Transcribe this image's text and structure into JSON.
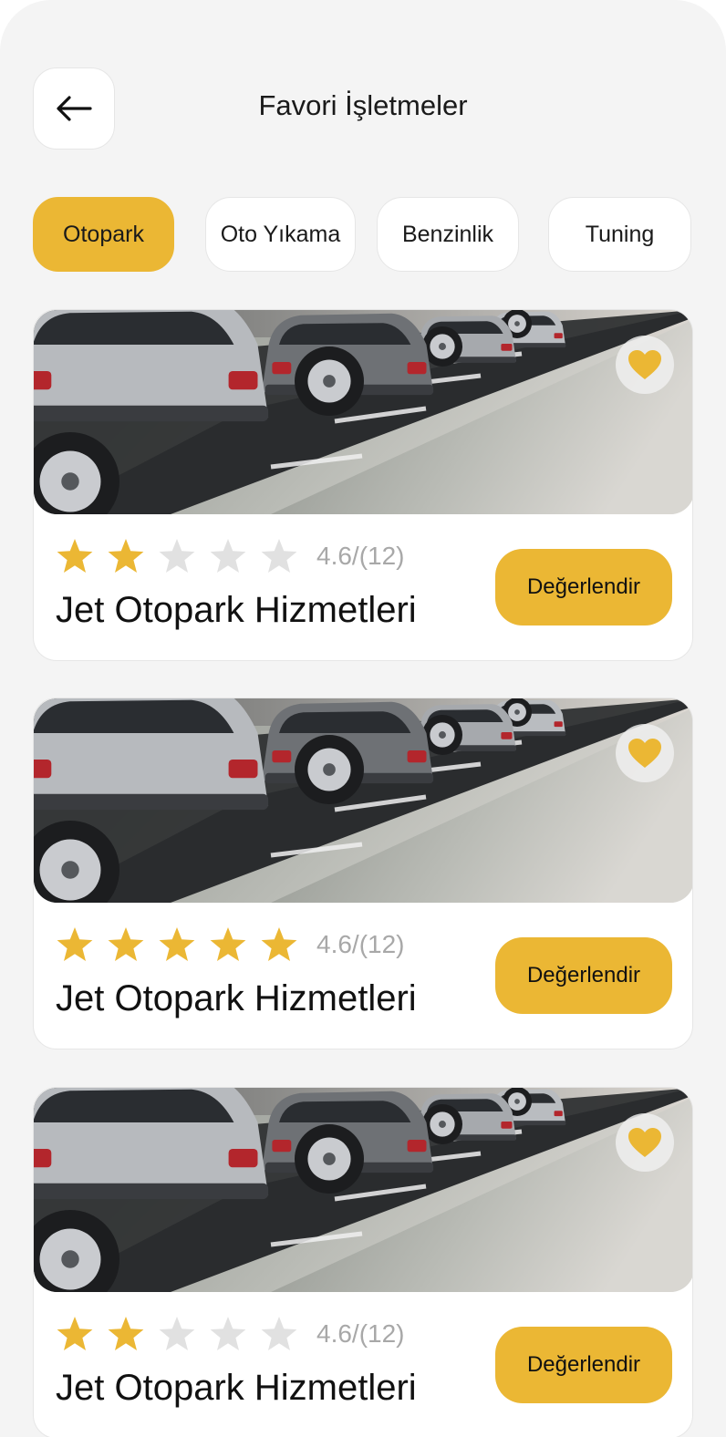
{
  "header": {
    "title": "Favori İşletmeler"
  },
  "tabs": [
    {
      "label": "Otopark",
      "active": true
    },
    {
      "label": "Oto Yıkama",
      "active": false
    },
    {
      "label": "Benzinlik",
      "active": false
    },
    {
      "label": "Tuning",
      "active": false
    }
  ],
  "listings": [
    {
      "name": "Jet Otopark Hizmetleri",
      "rating_text": "4.6/(12)",
      "stars_filled": 2,
      "stars_total": 5,
      "button_label": "Değerlendir",
      "favorite": true
    },
    {
      "name": "Jet Otopark Hizmetleri",
      "rating_text": "4.6/(12)",
      "stars_filled": 5,
      "stars_total": 5,
      "button_label": "Değerlendir",
      "favorite": true
    },
    {
      "name": "Jet Otopark Hizmetleri",
      "rating_text": "4.6/(12)",
      "stars_filled": 2,
      "stars_total": 5,
      "button_label": "Değerlendir",
      "favorite": true
    }
  ],
  "icons": {
    "back": "arrow-left-icon",
    "favorite": "heart-icon",
    "rating": "star-icon"
  },
  "colors": {
    "accent": "#ebb734",
    "star_empty": "#e1e1e1",
    "background": "#f4f4f4"
  }
}
